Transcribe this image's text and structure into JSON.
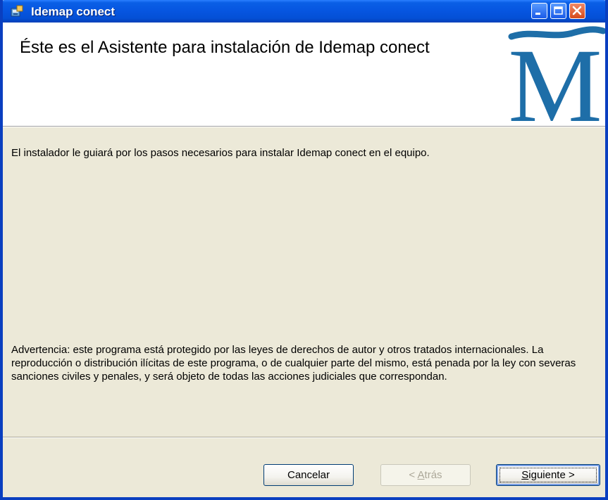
{
  "window": {
    "title": "Idemap conect",
    "controls": [
      "minimize-icon",
      "maximize-icon",
      "close-icon"
    ]
  },
  "header": {
    "title": "Éste es el Asistente para instalación de Idemap conect",
    "logo_letter": "M"
  },
  "body": {
    "intro": "El instalador le guiará por los pasos necesarios para instalar Idemap conect en el equipo.",
    "warning": "Advertencia: este programa está protegido por las leyes de derechos de autor y otros tratados internacionales. La reproducción o distribución ilícitas de este programa, o de cualquier parte del mismo, está penada por la ley con severas sanciones civiles y penales, y será objeto de todas las acciones judiciales que correspondan."
  },
  "buttons": {
    "cancel": "Cancelar",
    "back_prefix": "< ",
    "back_access": "A",
    "back_rest": "trás",
    "next_access": "S",
    "next_rest": "iguiente >",
    "back_enabled": false
  },
  "colors": {
    "titlebar": "#0655e0",
    "dialog_bg": "#ece9d8",
    "logo_blue": "#1e6ea8"
  }
}
